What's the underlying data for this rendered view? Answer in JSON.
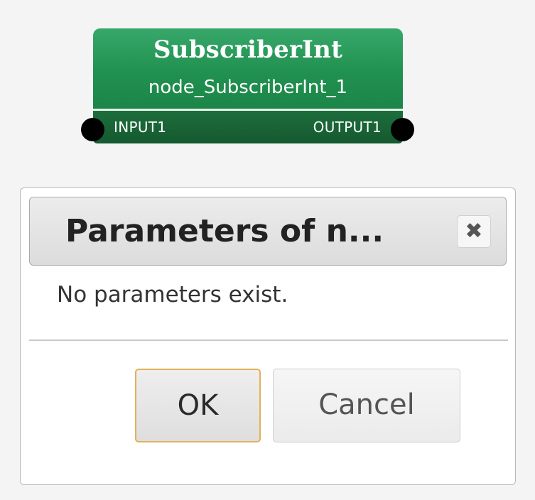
{
  "node": {
    "title": "SubscriberInt",
    "subtitle": "node_SubscriberInt_1",
    "input_port_label": "INPUT1",
    "output_port_label": "OUTPUT1",
    "header_color": "#219150",
    "port_bar_color": "#155930"
  },
  "dialog": {
    "title": "Parameters of n...",
    "close_icon": "close-icon",
    "close_glyph": "✖",
    "message": "No parameters exist.",
    "ok_label": "OK",
    "cancel_label": "Cancel",
    "ok_focus_color": "#e2b15a"
  }
}
